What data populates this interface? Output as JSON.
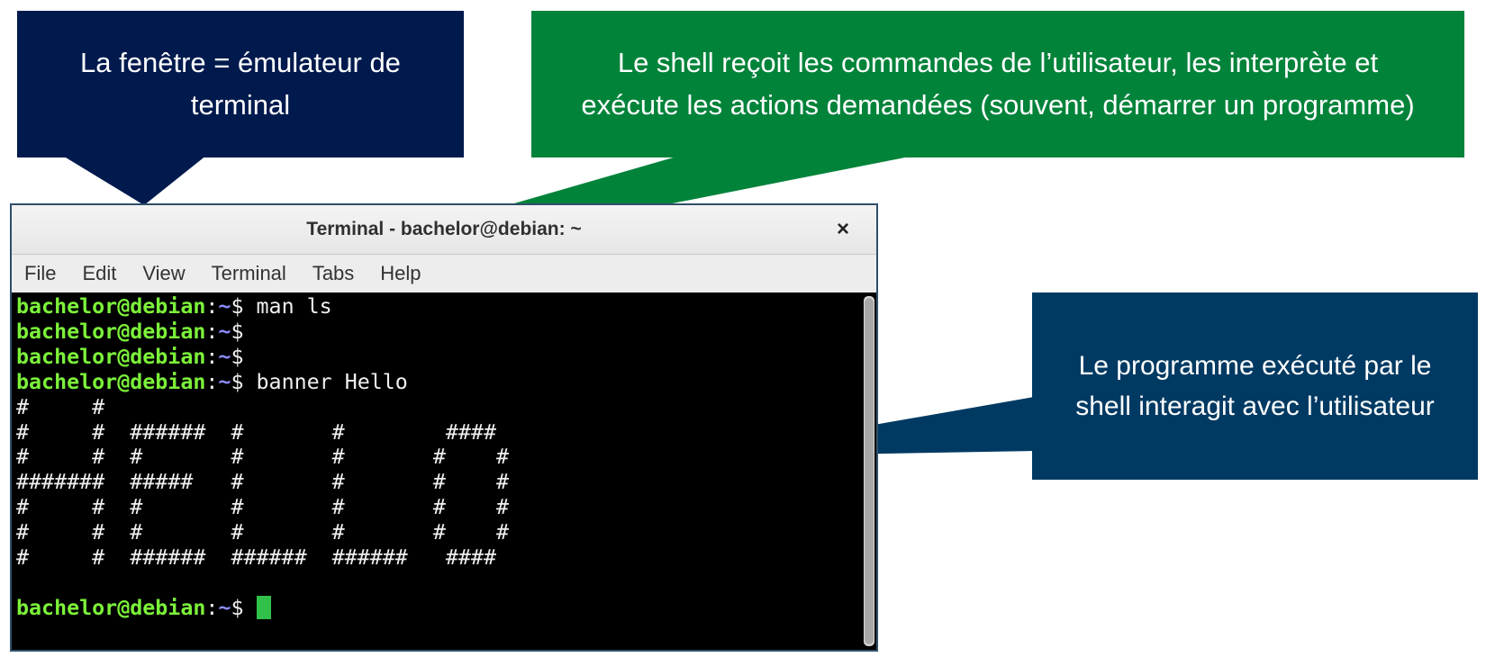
{
  "callouts": {
    "window": [
      "La fenêtre = émulateur de",
      "terminal"
    ],
    "shell": [
      "Le shell reçoit les commandes de l’utilisateur, les interprète et",
      "exécute les actions demandées (souvent, démarrer un programme)"
    ],
    "program": [
      "Le programme exécuté par le",
      "shell interagit avec l’utilisateur"
    ]
  },
  "terminal": {
    "title": "Terminal - bachelor@debian: ~",
    "close_icon": "×",
    "menu": [
      "File",
      "Edit",
      "View",
      "Terminal",
      "Tabs",
      "Help"
    ],
    "prompt_user": "bachelor@debian",
    "prompt_colon": ":",
    "prompt_path": "~",
    "prompt_symbol": "$",
    "commands": [
      "man ls",
      "",
      "",
      "banner Hello"
    ],
    "banner_output": [
      "#     #",
      "#     #  ######  #       #        ####",
      "#     #  #       #       #       #    #",
      "#######  #####   #       #       #    #",
      "#     #  #       #       #       #    #",
      "#     #  #       #       #       #    #",
      "#     #  ######  ######  ######   ####",
      ""
    ],
    "cursor_color": "#31c14a"
  },
  "colors": {
    "window_callout": "#001a4d",
    "shell_callout": "#02833a",
    "program_callout": "#003a63"
  }
}
